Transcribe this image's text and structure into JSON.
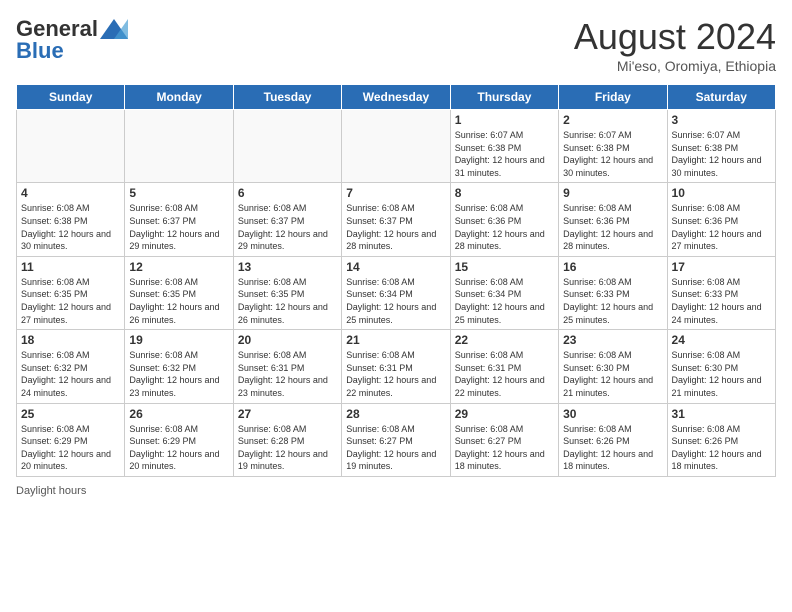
{
  "header": {
    "logo_general": "General",
    "logo_blue": "Blue",
    "month_year": "August 2024",
    "location": "Mi'eso, Oromiya, Ethiopia"
  },
  "calendar": {
    "days_of_week": [
      "Sunday",
      "Monday",
      "Tuesday",
      "Wednesday",
      "Thursday",
      "Friday",
      "Saturday"
    ],
    "weeks": [
      [
        {
          "day": "",
          "info": ""
        },
        {
          "day": "",
          "info": ""
        },
        {
          "day": "",
          "info": ""
        },
        {
          "day": "",
          "info": ""
        },
        {
          "day": "1",
          "info": "Sunrise: 6:07 AM\nSunset: 6:38 PM\nDaylight: 12 hours and 31 minutes."
        },
        {
          "day": "2",
          "info": "Sunrise: 6:07 AM\nSunset: 6:38 PM\nDaylight: 12 hours and 30 minutes."
        },
        {
          "day": "3",
          "info": "Sunrise: 6:07 AM\nSunset: 6:38 PM\nDaylight: 12 hours and 30 minutes."
        }
      ],
      [
        {
          "day": "4",
          "info": "Sunrise: 6:08 AM\nSunset: 6:38 PM\nDaylight: 12 hours and 30 minutes."
        },
        {
          "day": "5",
          "info": "Sunrise: 6:08 AM\nSunset: 6:37 PM\nDaylight: 12 hours and 29 minutes."
        },
        {
          "day": "6",
          "info": "Sunrise: 6:08 AM\nSunset: 6:37 PM\nDaylight: 12 hours and 29 minutes."
        },
        {
          "day": "7",
          "info": "Sunrise: 6:08 AM\nSunset: 6:37 PM\nDaylight: 12 hours and 28 minutes."
        },
        {
          "day": "8",
          "info": "Sunrise: 6:08 AM\nSunset: 6:36 PM\nDaylight: 12 hours and 28 minutes."
        },
        {
          "day": "9",
          "info": "Sunrise: 6:08 AM\nSunset: 6:36 PM\nDaylight: 12 hours and 28 minutes."
        },
        {
          "day": "10",
          "info": "Sunrise: 6:08 AM\nSunset: 6:36 PM\nDaylight: 12 hours and 27 minutes."
        }
      ],
      [
        {
          "day": "11",
          "info": "Sunrise: 6:08 AM\nSunset: 6:35 PM\nDaylight: 12 hours and 27 minutes."
        },
        {
          "day": "12",
          "info": "Sunrise: 6:08 AM\nSunset: 6:35 PM\nDaylight: 12 hours and 26 minutes."
        },
        {
          "day": "13",
          "info": "Sunrise: 6:08 AM\nSunset: 6:35 PM\nDaylight: 12 hours and 26 minutes."
        },
        {
          "day": "14",
          "info": "Sunrise: 6:08 AM\nSunset: 6:34 PM\nDaylight: 12 hours and 25 minutes."
        },
        {
          "day": "15",
          "info": "Sunrise: 6:08 AM\nSunset: 6:34 PM\nDaylight: 12 hours and 25 minutes."
        },
        {
          "day": "16",
          "info": "Sunrise: 6:08 AM\nSunset: 6:33 PM\nDaylight: 12 hours and 25 minutes."
        },
        {
          "day": "17",
          "info": "Sunrise: 6:08 AM\nSunset: 6:33 PM\nDaylight: 12 hours and 24 minutes."
        }
      ],
      [
        {
          "day": "18",
          "info": "Sunrise: 6:08 AM\nSunset: 6:32 PM\nDaylight: 12 hours and 24 minutes."
        },
        {
          "day": "19",
          "info": "Sunrise: 6:08 AM\nSunset: 6:32 PM\nDaylight: 12 hours and 23 minutes."
        },
        {
          "day": "20",
          "info": "Sunrise: 6:08 AM\nSunset: 6:31 PM\nDaylight: 12 hours and 23 minutes."
        },
        {
          "day": "21",
          "info": "Sunrise: 6:08 AM\nSunset: 6:31 PM\nDaylight: 12 hours and 22 minutes."
        },
        {
          "day": "22",
          "info": "Sunrise: 6:08 AM\nSunset: 6:31 PM\nDaylight: 12 hours and 22 minutes."
        },
        {
          "day": "23",
          "info": "Sunrise: 6:08 AM\nSunset: 6:30 PM\nDaylight: 12 hours and 21 minutes."
        },
        {
          "day": "24",
          "info": "Sunrise: 6:08 AM\nSunset: 6:30 PM\nDaylight: 12 hours and 21 minutes."
        }
      ],
      [
        {
          "day": "25",
          "info": "Sunrise: 6:08 AM\nSunset: 6:29 PM\nDaylight: 12 hours and 20 minutes."
        },
        {
          "day": "26",
          "info": "Sunrise: 6:08 AM\nSunset: 6:29 PM\nDaylight: 12 hours and 20 minutes."
        },
        {
          "day": "27",
          "info": "Sunrise: 6:08 AM\nSunset: 6:28 PM\nDaylight: 12 hours and 19 minutes."
        },
        {
          "day": "28",
          "info": "Sunrise: 6:08 AM\nSunset: 6:27 PM\nDaylight: 12 hours and 19 minutes."
        },
        {
          "day": "29",
          "info": "Sunrise: 6:08 AM\nSunset: 6:27 PM\nDaylight: 12 hours and 18 minutes."
        },
        {
          "day": "30",
          "info": "Sunrise: 6:08 AM\nSunset: 6:26 PM\nDaylight: 12 hours and 18 minutes."
        },
        {
          "day": "31",
          "info": "Sunrise: 6:08 AM\nSunset: 6:26 PM\nDaylight: 12 hours and 18 minutes."
        }
      ]
    ]
  },
  "footer": {
    "daylight_label": "Daylight hours"
  }
}
